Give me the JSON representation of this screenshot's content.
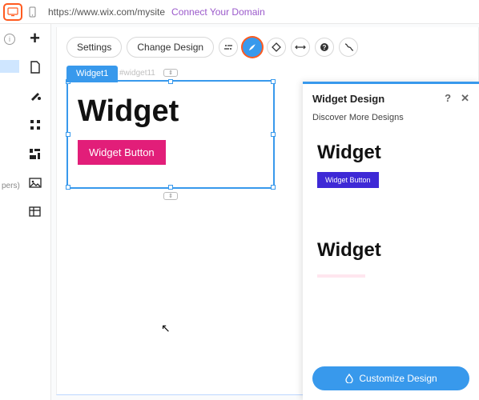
{
  "topbar": {
    "url": "https://www.wix.com/mysite",
    "connect": "Connect Your Domain"
  },
  "leftpane_label": "pers)",
  "float_toolbar": {
    "settings": "Settings",
    "change_design": "Change Design"
  },
  "widget": {
    "tab": "Widget1",
    "id": "#widget11",
    "heading": "Widget",
    "button": "Widget Button"
  },
  "panel": {
    "title": "Widget Design",
    "help": "?",
    "close": "✕",
    "subtitle": "Discover More Designs",
    "designs": [
      {
        "heading": "Widget",
        "button": "Widget Button"
      },
      {
        "heading": "Widget"
      }
    ],
    "customize": "Customize Design"
  }
}
